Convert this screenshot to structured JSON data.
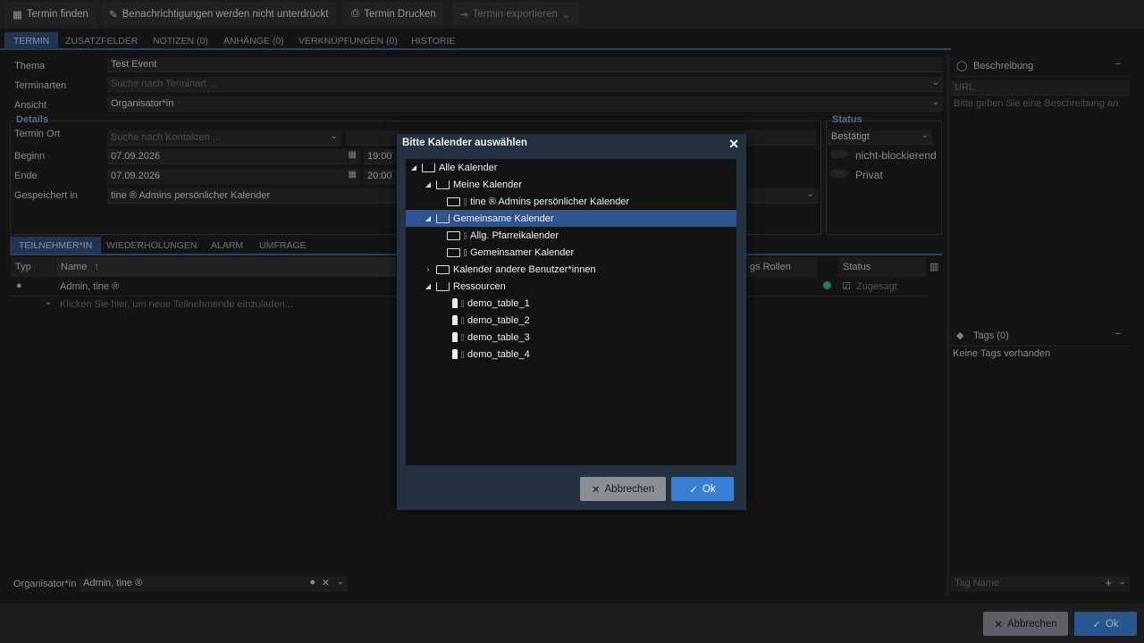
{
  "toolbar": {
    "find_label": "Termin finden",
    "notify_label": "Benachrichtigungen werden nicht unterdrückt",
    "print_label": "Termin Drucken",
    "export_label": "Termin exportieren"
  },
  "tabs": [
    "TERMIN",
    "ZUSATZFELDER",
    "NOTIZEN (0)",
    "ANHÄNGE (0)",
    "VERKNÜPFUNGEN (0)",
    "HISTORIE"
  ],
  "form": {
    "thema_label": "Thema",
    "thema_value": "Test Event",
    "terminarten_label": "Terminarten",
    "terminarten_placeholder": "Suche nach Terminart ...",
    "ansicht_label": "Ansicht",
    "ansicht_value": "Organisator*in",
    "details_legend": "Details",
    "ort_label": "Termin Ort",
    "ort_placeholder": "Suche nach Kontakten ...",
    "beginn_label": "Beginn",
    "beginn_date": "07.09.2026",
    "beginn_time": "19:00",
    "ende_label": "Ende",
    "ende_date": "07.09.2026",
    "ende_time": "20:00",
    "saved_label": "Gespeichert in",
    "saved_value": "tine ® Admins persönlicher Kalender",
    "status_legend": "Status",
    "status_value": "Bestätigt",
    "toggle1": "nicht-blockierend",
    "toggle2": "Privat"
  },
  "subtabs": [
    "TEILNEHMER*IN",
    "WIEDERHOLUNGEN",
    "ALARM",
    "UMFRAGE"
  ],
  "grid": {
    "col_typ": "Typ",
    "col_name": "Name",
    "col_rollen": "gs Rollen",
    "col_status": "Status",
    "row_name": "Admin, tine ®",
    "row_status": "Zugesagt",
    "invite_placeholder": "Klicken Sie hier, um neue Teilnehmende einzuladen..."
  },
  "organizer": {
    "label": "Organisator*in",
    "value": "Admin, tine ®"
  },
  "right": {
    "desc_title": "Beschreibung",
    "url_placeholder": "URL",
    "desc_placeholder": "Bitte geben Sie eine Beschreibung an",
    "tags_title": "Tags (0)",
    "tags_empty": "Keine Tags vorhanden",
    "tag_name_placeholder": "Tag Name"
  },
  "dialog": {
    "title": "Bitte Kalender auswählen",
    "tree": [
      "Alle Kalender",
      "Meine Kalender",
      "tine ® Admins persönlicher Kalender",
      "Gemeinsame Kalender",
      "Allg. Pfarreikalender",
      "Gemeinsamer Kalender",
      "Kalender andere Benutzer*innen",
      "Ressourcen",
      "demo_table_1",
      "demo_table_2",
      "demo_table_3",
      "demo_table_4"
    ],
    "cancel_label": "Abbrechen",
    "ok_label": "Ok"
  },
  "footer": {
    "cancel_label": "Abbrechen",
    "ok_label": "Ok"
  },
  "colors": {
    "accent": "#3a7fd6",
    "selected": "#2e5591",
    "legend": "#7fa4d4",
    "status_green": "#3bb37c"
  }
}
